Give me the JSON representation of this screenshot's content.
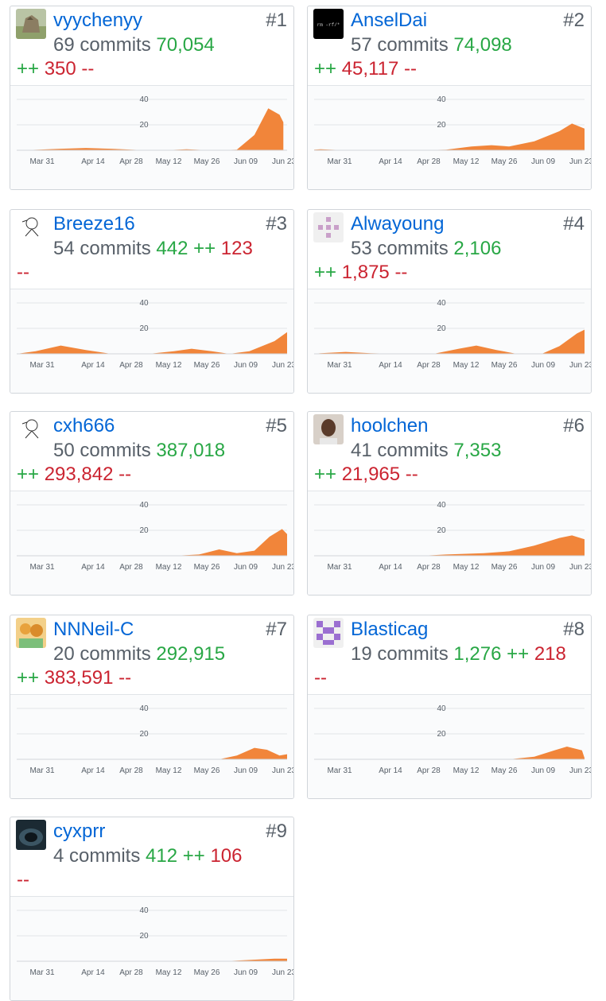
{
  "x_labels": [
    "Mar 31",
    "Apr 14",
    "Apr 28",
    "May 12",
    "May 26",
    "Jun 09",
    "Jun 23"
  ],
  "y_labels": [
    "40",
    "20"
  ],
  "area_color": "#f1853a",
  "add_suffix": "++",
  "del_suffix": "--",
  "contributors": [
    {
      "rank": "#1",
      "username": "vyychenyy",
      "commits": "69 commits",
      "additions": "70,054",
      "deletions": "350",
      "avatar_icon": "wolf-photo-avatar",
      "chart_data": {
        "type": "area",
        "x": [
          "Mar 31",
          "Apr 14",
          "Apr 28",
          "May 12",
          "May 26",
          "Jun 09",
          "Jun 23"
        ],
        "ylim": [
          0,
          40
        ],
        "series": [
          {
            "points": [
              [
                0,
                0
              ],
              [
                0.15,
                1.2
              ],
              [
                0.25,
                1.8
              ],
              [
                0.35,
                1.2
              ],
              [
                0.45,
                0.3
              ],
              [
                0.5,
                0
              ],
              [
                0.58,
                0.2
              ],
              [
                0.65,
                0.8
              ],
              [
                0.72,
                0.2
              ],
              [
                0.78,
                0
              ],
              [
                0.85,
                0.5
              ],
              [
                0.92,
                12
              ],
              [
                0.975,
                33
              ],
              [
                1.02,
                28
              ],
              [
                1.035,
                22
              ]
            ]
          }
        ]
      }
    },
    {
      "rank": "#2",
      "username": "AnselDai",
      "commits": "57 commits",
      "additions": "74,098",
      "deletions": "45,117",
      "avatar_icon": "dark-square-avatar",
      "chart_data": {
        "type": "area",
        "x": [
          "Mar 31",
          "Apr 14",
          "Apr 28",
          "May 12",
          "May 26",
          "Jun 09",
          "Jun 23"
        ],
        "ylim": [
          0,
          40
        ],
        "series": [
          {
            "points": [
              [
                -0.1,
                0.5
              ],
              [
                0.0,
                0.8
              ],
              [
                0.08,
                0.2
              ],
              [
                0.2,
                0
              ],
              [
                0.4,
                0
              ],
              [
                0.5,
                0.5
              ],
              [
                0.6,
                3
              ],
              [
                0.68,
                4
              ],
              [
                0.75,
                3
              ],
              [
                0.85,
                7
              ],
              [
                0.95,
                15
              ],
              [
                1.0,
                21
              ],
              [
                1.05,
                17
              ],
              [
                1.1,
                4
              ]
            ]
          }
        ]
      }
    },
    {
      "rank": "#3",
      "username": "Breeze16",
      "commits": "54 commits",
      "additions": "442",
      "deletions": "123",
      "avatar_icon": "sketch-character-avatar",
      "chart_data": {
        "type": "area",
        "x": [
          "Mar 31",
          "Apr 14",
          "Apr 28",
          "May 12",
          "May 26",
          "Jun 09",
          "Jun 23"
        ],
        "ylim": [
          0,
          40
        ],
        "series": [
          {
            "points": [
              [
                -0.1,
                0
              ],
              [
                0.05,
                2
              ],
              [
                0.15,
                6.5
              ],
              [
                0.25,
                3
              ],
              [
                0.35,
                0
              ],
              [
                0.5,
                0
              ],
              [
                0.6,
                2
              ],
              [
                0.67,
                4
              ],
              [
                0.75,
                2
              ],
              [
                0.82,
                0
              ],
              [
                0.9,
                2
              ],
              [
                1.0,
                10
              ],
              [
                1.07,
                17
              ],
              [
                1.12,
                15
              ],
              [
                1.15,
                8
              ]
            ]
          }
        ]
      }
    },
    {
      "rank": "#4",
      "username": "Alwayoung",
      "commits": "53 commits",
      "additions": "2,106",
      "deletions": "1,875",
      "avatar_icon": "pink-identicon-avatar",
      "chart_data": {
        "type": "area",
        "x": [
          "Mar 31",
          "Apr 14",
          "Apr 28",
          "May 12",
          "May 26",
          "Jun 09",
          "Jun 23"
        ],
        "ylim": [
          0,
          40
        ],
        "series": [
          {
            "points": [
              [
                -0.1,
                0
              ],
              [
                0.0,
                0.5
              ],
              [
                0.1,
                1.5
              ],
              [
                0.2,
                0.5
              ],
              [
                0.3,
                0
              ],
              [
                0.45,
                0
              ],
              [
                0.55,
                4
              ],
              [
                0.62,
                6.5
              ],
              [
                0.7,
                3
              ],
              [
                0.78,
                0
              ],
              [
                0.88,
                0
              ],
              [
                0.95,
                6
              ],
              [
                1.02,
                16
              ],
              [
                1.08,
                19
              ],
              [
                1.12,
                19
              ]
            ]
          }
        ]
      }
    },
    {
      "rank": "#5",
      "username": "cxh666",
      "commits": "50 commits",
      "additions": "387,018",
      "deletions": "293,842",
      "avatar_icon": "sketch-character-avatar",
      "chart_data": {
        "type": "area",
        "x": [
          "Mar 31",
          "Apr 14",
          "Apr 28",
          "May 12",
          "May 26",
          "Jun 09",
          "Jun 23"
        ],
        "ylim": [
          0,
          40
        ],
        "series": [
          {
            "points": [
              [
                0.6,
                0
              ],
              [
                0.7,
                1
              ],
              [
                0.78,
                5
              ],
              [
                0.85,
                2
              ],
              [
                0.92,
                4
              ],
              [
                0.98,
                15
              ],
              [
                1.03,
                21
              ],
              [
                1.08,
                17
              ],
              [
                1.11,
                12
              ]
            ]
          }
        ]
      }
    },
    {
      "rank": "#6",
      "username": "hoolchen",
      "commits": "41 commits",
      "additions": "7,353",
      "deletions": "21,965",
      "avatar_icon": "person-photo-avatar",
      "chart_data": {
        "type": "area",
        "x": [
          "Mar 31",
          "Apr 14",
          "Apr 28",
          "May 12",
          "May 26",
          "Jun 09",
          "Jun 23"
        ],
        "ylim": [
          0,
          40
        ],
        "series": [
          {
            "points": [
              [
                0.4,
                0
              ],
              [
                0.5,
                1
              ],
              [
                0.65,
                2
              ],
              [
                0.75,
                3.5
              ],
              [
                0.85,
                8
              ],
              [
                0.95,
                14
              ],
              [
                1.0,
                16
              ],
              [
                1.05,
                13
              ],
              [
                1.1,
                3
              ]
            ]
          }
        ]
      }
    },
    {
      "rank": "#7",
      "username": "NNNeil-C",
      "commits": "20 commits",
      "additions": "292,915",
      "deletions": "383,591",
      "avatar_icon": "cartoon-group-avatar",
      "chart_data": {
        "type": "area",
        "x": [
          "Mar 31",
          "Apr 14",
          "Apr 28",
          "May 12",
          "May 26",
          "Jun 09",
          "Jun 23"
        ],
        "ylim": [
          0,
          40
        ],
        "series": [
          {
            "points": [
              [
                0.78,
                0
              ],
              [
                0.85,
                3
              ],
              [
                0.92,
                9
              ],
              [
                0.97,
                7.5
              ],
              [
                1.02,
                3
              ],
              [
                1.08,
                4
              ],
              [
                1.12,
                4.5
              ]
            ]
          }
        ]
      }
    },
    {
      "rank": "#8",
      "username": "Blasticag",
      "commits": "19 commits",
      "additions": "1,276",
      "deletions": "218",
      "avatar_icon": "purple-identicon-avatar",
      "chart_data": {
        "type": "area",
        "x": [
          "Mar 31",
          "Apr 14",
          "Apr 28",
          "May 12",
          "May 26",
          "Jun 09",
          "Jun 23"
        ],
        "ylim": [
          0,
          40
        ],
        "series": [
          {
            "points": [
              [
                0.75,
                0
              ],
              [
                0.85,
                2
              ],
              [
                0.93,
                7
              ],
              [
                0.98,
                10
              ],
              [
                1.04,
                7
              ],
              [
                1.09,
                1
              ]
            ]
          }
        ]
      }
    },
    {
      "rank": "#9",
      "username": "cyxprr",
      "commits": "4 commits",
      "additions": "412",
      "deletions": "106",
      "avatar_icon": "dark-blue-photo-avatar",
      "chart_data": {
        "type": "area",
        "x": [
          "Mar 31",
          "Apr 14",
          "Apr 28",
          "May 12",
          "May 26",
          "Jun 09",
          "Jun 23"
        ],
        "ylim": [
          0,
          40
        ],
        "series": [
          {
            "points": [
              [
                0.8,
                0
              ],
              [
                0.9,
                1
              ],
              [
                1.0,
                2
              ],
              [
                1.12,
                2
              ]
            ]
          }
        ]
      }
    }
  ]
}
